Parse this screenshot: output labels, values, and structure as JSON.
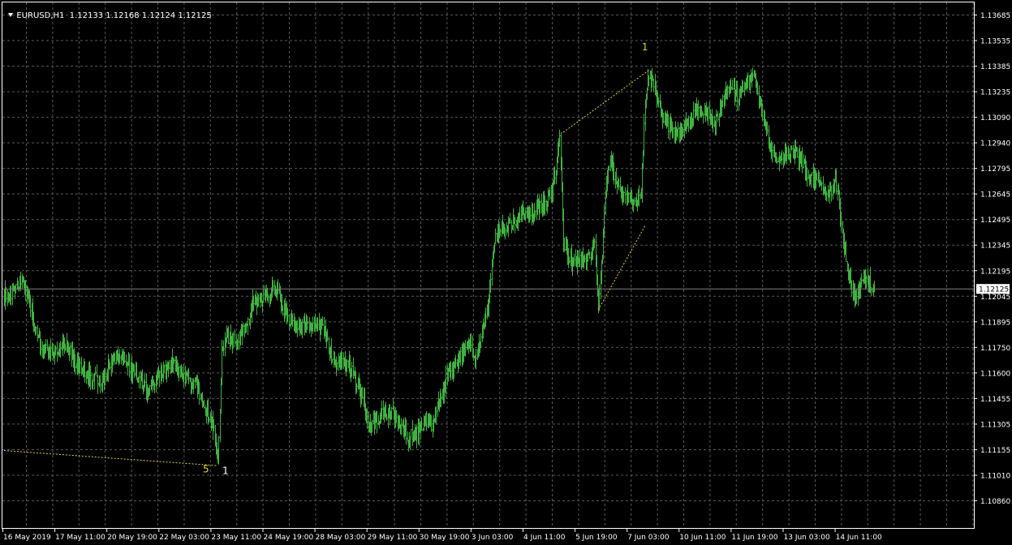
{
  "header": {
    "symbol": "EURUSD,H1",
    "ohlc": "1.12133 1.12168 1.12124 1.12125"
  },
  "colors": {
    "background": "#000000",
    "grid": "#5a5a5a",
    "candles": "#3fb23f",
    "axis_text": "#ffffff",
    "annotation_yellow": "#e8d22a",
    "annotation_white": "#ffffff",
    "price_line": "#7e7e7e",
    "price_label_bg": "#ffffff",
    "price_label_text": "#000000"
  },
  "chart_data": {
    "type": "bar",
    "ylim": [
      1.1086,
      1.1376
    ],
    "y_ticks": [
      "1.13685",
      "1.13535",
      "1.13385",
      "1.13235",
      "1.13090",
      "1.12940",
      "1.12795",
      "1.12645",
      "1.12495",
      "1.12345",
      "1.12195",
      "1.12045",
      "1.11895",
      "1.11750",
      "1.11600",
      "1.11455",
      "1.11305",
      "1.11155",
      "1.11010",
      "1.10860"
    ],
    "x_ticks": [
      "16 May 2019",
      "17 May 11:00",
      "20 May 19:00",
      "22 May 03:00",
      "23 May 11:00",
      "24 May 19:00",
      "28 May 03:00",
      "29 May 11:00",
      "30 May 19:00",
      "3 Jun 03:00",
      "4 Jun 11:00",
      "5 Jun 19:00",
      "7 Jun 03:00",
      "10 Jun 11:00",
      "11 Jun 19:00",
      "13 Jun 03:00",
      "14 Jun 11:00"
    ],
    "current_price": "1.12125",
    "path_points": [
      [
        0,
        1.1208
      ],
      [
        2,
        1.121
      ],
      [
        5,
        1.1217
      ],
      [
        7,
        1.12
      ],
      [
        9,
        1.118
      ],
      [
        10,
        1.1175
      ],
      [
        13,
        1.1175
      ],
      [
        16,
        1.118
      ],
      [
        18,
        1.117
      ],
      [
        20,
        1.1165
      ],
      [
        22,
        1.116
      ],
      [
        25,
        1.1158
      ],
      [
        27,
        1.1166
      ],
      [
        30,
        1.1173
      ],
      [
        32,
        1.1167
      ],
      [
        35,
        1.1158
      ],
      [
        37,
        1.115
      ],
      [
        40,
        1.1162
      ],
      [
        43,
        1.1168
      ],
      [
        46,
        1.116
      ],
      [
        48,
        1.1157
      ],
      [
        50,
        1.1152
      ],
      [
        52,
        1.114
      ],
      [
        54,
        1.1128
      ],
      [
        55,
        1.111
      ],
      [
        56,
        1.1175
      ],
      [
        57,
        1.1183
      ],
      [
        59,
        1.1182
      ],
      [
        62,
        1.1188
      ],
      [
        64,
        1.1204
      ],
      [
        66,
        1.1206
      ],
      [
        68,
        1.121
      ],
      [
        70,
        1.1212
      ],
      [
        72,
        1.12
      ],
      [
        74,
        1.1192
      ],
      [
        76,
        1.119
      ],
      [
        78,
        1.1192
      ],
      [
        80,
        1.1188
      ],
      [
        82,
        1.1189
      ],
      [
        84,
        1.1175
      ],
      [
        86,
        1.1168
      ],
      [
        88,
        1.117
      ],
      [
        90,
        1.116
      ],
      [
        92,
        1.115
      ],
      [
        94,
        1.113
      ],
      [
        96,
        1.1135
      ],
      [
        98,
        1.1138
      ],
      [
        100,
        1.1138
      ],
      [
        102,
        1.1132
      ],
      [
        104,
        1.1124
      ],
      [
        106,
        1.1126
      ],
      [
        108,
        1.1133
      ],
      [
        110,
        1.1132
      ],
      [
        112,
        1.1145
      ],
      [
        114,
        1.116
      ],
      [
        116,
        1.1168
      ],
      [
        118,
        1.1175
      ],
      [
        120,
        1.118
      ],
      [
        121,
        1.117
      ],
      [
        122,
        1.1178
      ],
      [
        124,
        1.1195
      ],
      [
        125,
        1.121
      ],
      [
        126,
        1.124
      ],
      [
        127,
        1.1248
      ],
      [
        129,
        1.125
      ],
      [
        131,
        1.1252
      ],
      [
        133,
        1.1258
      ],
      [
        135,
        1.1255
      ],
      [
        137,
        1.1262
      ],
      [
        139,
        1.1264
      ],
      [
        141,
        1.1272
      ],
      [
        142,
        1.1285
      ],
      [
        143,
        1.13
      ],
      [
        144,
        1.124
      ],
      [
        146,
        1.123
      ],
      [
        148,
        1.1228
      ],
      [
        150,
        1.1232
      ],
      [
        152,
        1.1238
      ],
      [
        153,
        1.12
      ],
      [
        154,
        1.1235
      ],
      [
        155,
        1.1275
      ],
      [
        156,
        1.129
      ],
      [
        157,
        1.1278
      ],
      [
        159,
        1.127
      ],
      [
        161,
        1.1265
      ],
      [
        163,
        1.1262
      ],
      [
        164,
        1.127
      ],
      [
        165,
        1.1322
      ],
      [
        166,
        1.134
      ],
      [
        167,
        1.1337
      ],
      [
        169,
        1.132
      ],
      [
        171,
        1.131
      ],
      [
        173,
        1.1305
      ],
      [
        175,
        1.1308
      ],
      [
        177,
        1.1315
      ],
      [
        179,
        1.132
      ],
      [
        181,
        1.1318
      ],
      [
        183,
        1.1312
      ],
      [
        185,
        1.1325
      ],
      [
        187,
        1.1332
      ],
      [
        189,
        1.1328
      ],
      [
        191,
        1.1335
      ],
      [
        193,
        1.1338
      ],
      [
        195,
        1.132
      ],
      [
        197,
        1.1298
      ],
      [
        199,
        1.129
      ],
      [
        201,
        1.1292
      ],
      [
        203,
        1.1294
      ],
      [
        205,
        1.129
      ],
      [
        207,
        1.128
      ],
      [
        209,
        1.1278
      ],
      [
        211,
        1.1272
      ],
      [
        213,
        1.127
      ],
      [
        214,
        1.1278
      ],
      [
        215,
        1.1262
      ],
      [
        216,
        1.124
      ],
      [
        217,
        1.1228
      ],
      [
        218,
        1.1215
      ],
      [
        219,
        1.1207
      ],
      [
        220,
        1.121
      ],
      [
        221,
        1.1215
      ],
      [
        222,
        1.122
      ],
      [
        223,
        1.1215
      ],
      [
        224,
        1.1212
      ]
    ],
    "bars_total": 235,
    "annotations": [
      {
        "text": "1",
        "bar": 165,
        "price": 1.1355,
        "color": "yellow"
      },
      {
        "text": "5",
        "bar": 52,
        "price": 1.1103,
        "color": "yellow"
      },
      {
        "text": "1",
        "bar": 57,
        "price": 1.1102,
        "color": "white"
      }
    ],
    "dashed_lines": [
      {
        "from": [
          0,
          1.1116
        ],
        "to": [
          55,
          1.1107
        ]
      },
      {
        "from": [
          144,
          1.1306
        ],
        "to": [
          166,
          1.1343
        ]
      },
      {
        "from": [
          153,
          1.12
        ],
        "to": [
          165,
          1.125
        ]
      }
    ]
  }
}
